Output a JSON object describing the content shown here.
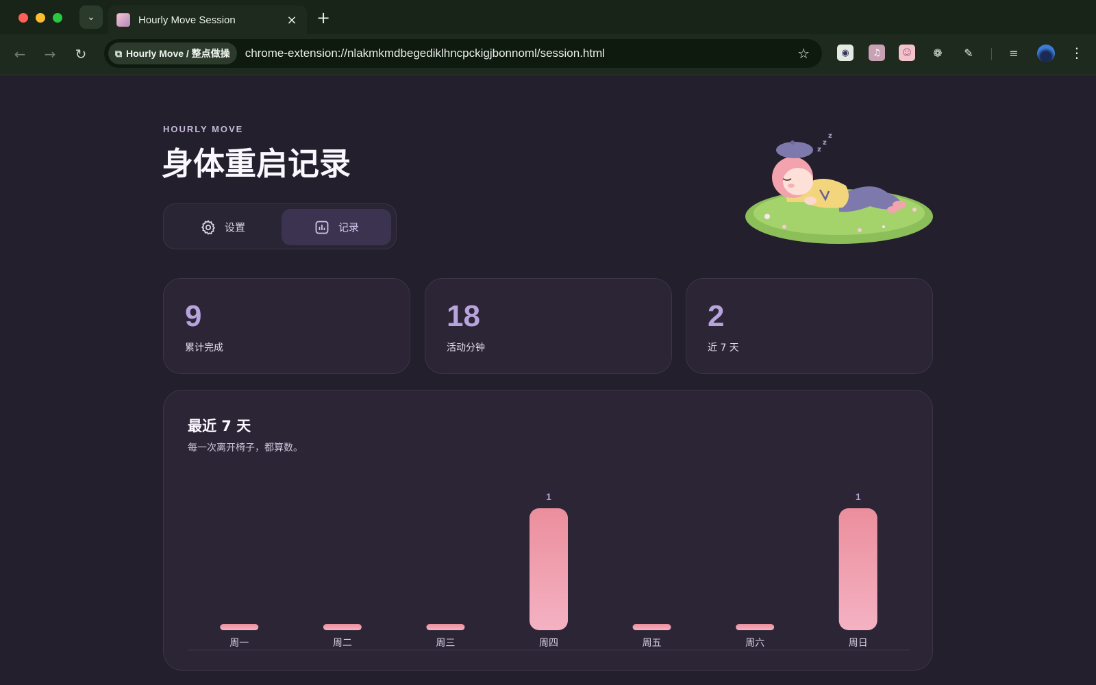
{
  "browser": {
    "tab_title": "Hourly Move Session",
    "site_chip": "Hourly Move / 整点做操",
    "url": "chrome-extension://nlakmkmdbegediklhncpckigjbonnoml/session.html",
    "icons": [
      "back-icon",
      "forward-icon",
      "reload-icon",
      "star-icon",
      "extensions-icon",
      "media-icon",
      "profile-avatar",
      "menu-icon"
    ]
  },
  "header": {
    "eyebrow": "HOURLY MOVE",
    "title": "身体重启记录"
  },
  "tabs": [
    {
      "label": "设置",
      "icon": "gear-icon",
      "active": false
    },
    {
      "label": "记录",
      "icon": "chart-icon",
      "active": true
    }
  ],
  "stats": [
    {
      "value": "9",
      "label": "累计完成"
    },
    {
      "value": "18",
      "label": "活动分钟"
    },
    {
      "value": "2",
      "label": "近 7 天"
    }
  ],
  "chart_card": {
    "title": "最近 7 天",
    "subtitle": "每一次离开椅子，都算数。"
  },
  "colors": {
    "accent": "#b7a4dc",
    "bar_top": "#ec8e9c",
    "bar_bottom": "#f4b2c3",
    "background": "#231f2c",
    "card": "#2b2536"
  },
  "chart_data": {
    "type": "bar",
    "categories": [
      "周一",
      "周二",
      "周三",
      "周四",
      "周五",
      "周六",
      "周日"
    ],
    "values": [
      0,
      0,
      0,
      1,
      0,
      0,
      1
    ],
    "data_labels": [
      "",
      "",
      "",
      "1",
      "",
      "",
      "1"
    ],
    "title": "最近 7 天",
    "xlabel": "",
    "ylabel": "",
    "ylim": [
      0,
      1
    ],
    "grid": false,
    "legend": "none"
  }
}
